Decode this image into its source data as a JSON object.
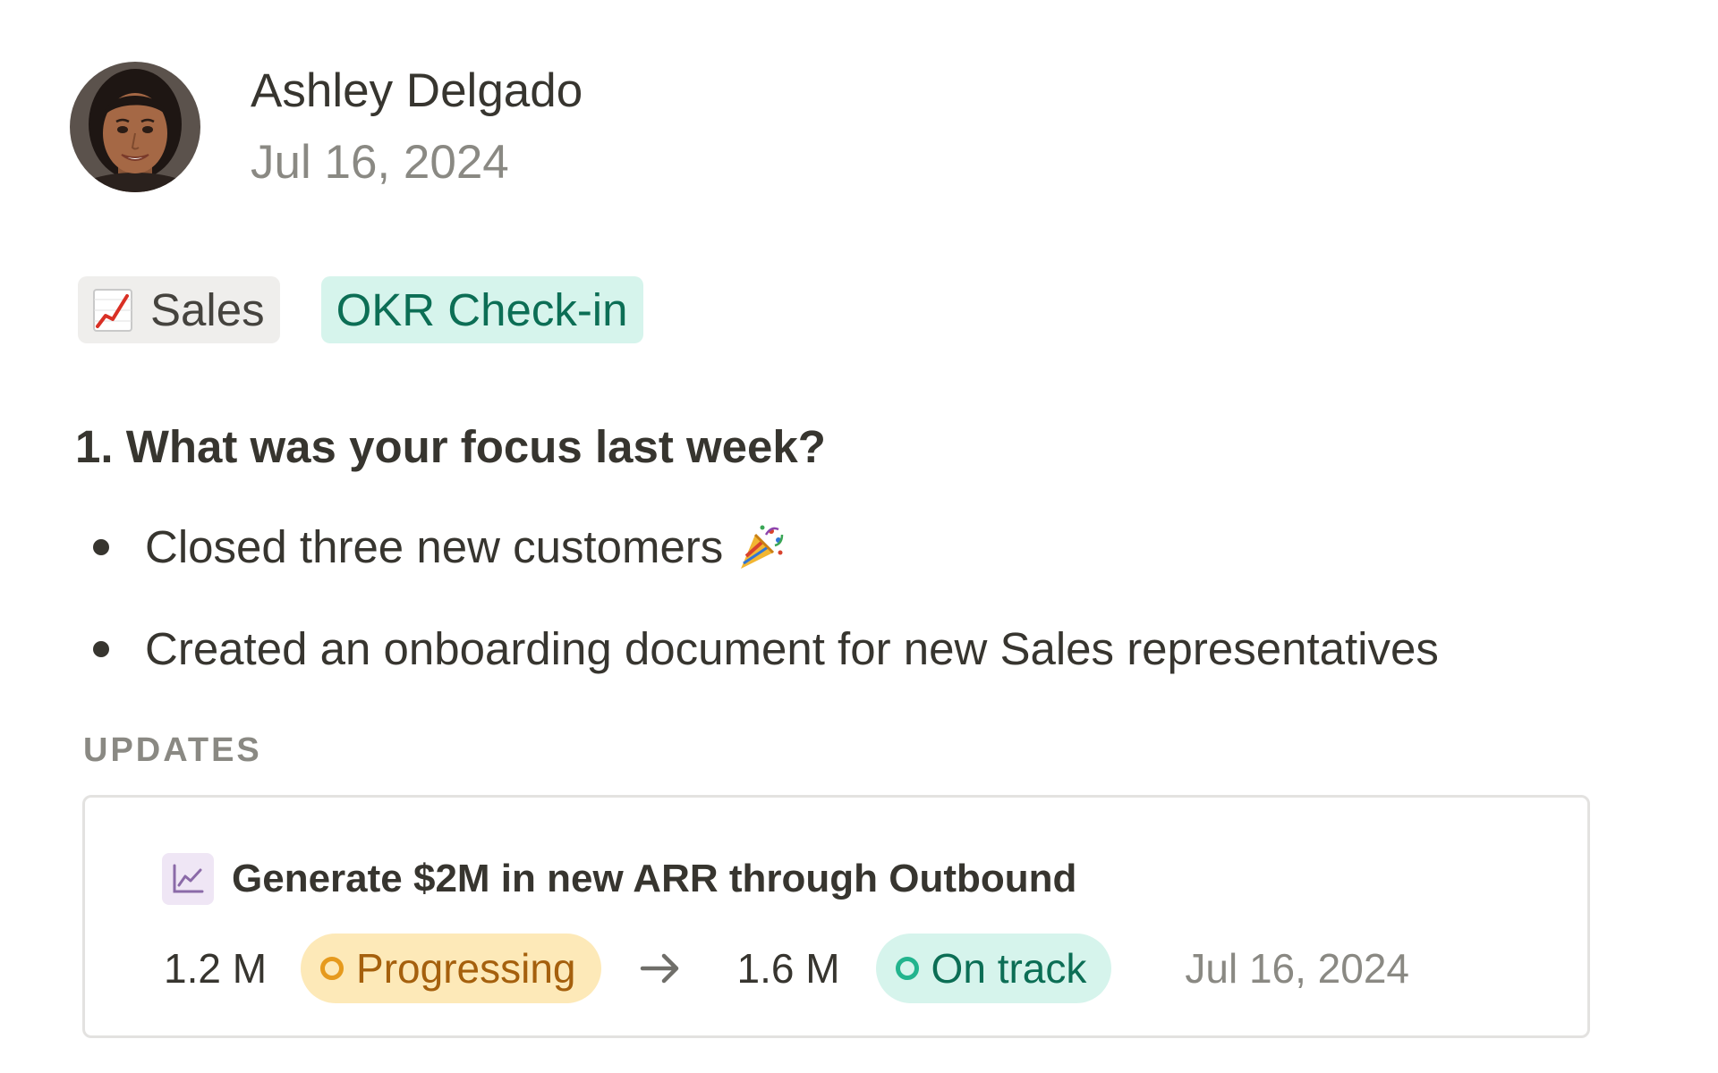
{
  "author": {
    "name": "Ashley Delgado",
    "date": "Jul 16, 2024",
    "avatar_icon": "user-avatar-photo"
  },
  "tags": {
    "sales": {
      "label": "Sales",
      "icon": "chart-increasing-emoji"
    },
    "okr": {
      "label": "OKR Check-in"
    }
  },
  "question": {
    "text": "1. What was your focus last week?"
  },
  "bullets": [
    {
      "text": "Closed three new customers",
      "icon": "party-popper-emoji"
    },
    {
      "text": "Created an onboarding document for new Sales representatives"
    }
  ],
  "updates": {
    "label": "UPDATES",
    "card": {
      "title": "Generate $2M in new ARR through Outbound",
      "icon": "line-chart-icon",
      "from_value": "1.2 M",
      "from_status": "Progressing",
      "to_value": "1.6 M",
      "to_status": "On track",
      "date": "Jul 16, 2024"
    }
  },
  "colors": {
    "text": "#37352f",
    "muted": "#8a8983",
    "progress_bg": "#fde9b8",
    "progress_text": "#a5600d",
    "ontrack_bg": "#d6f4ec",
    "ontrack_text": "#0c6e55"
  }
}
